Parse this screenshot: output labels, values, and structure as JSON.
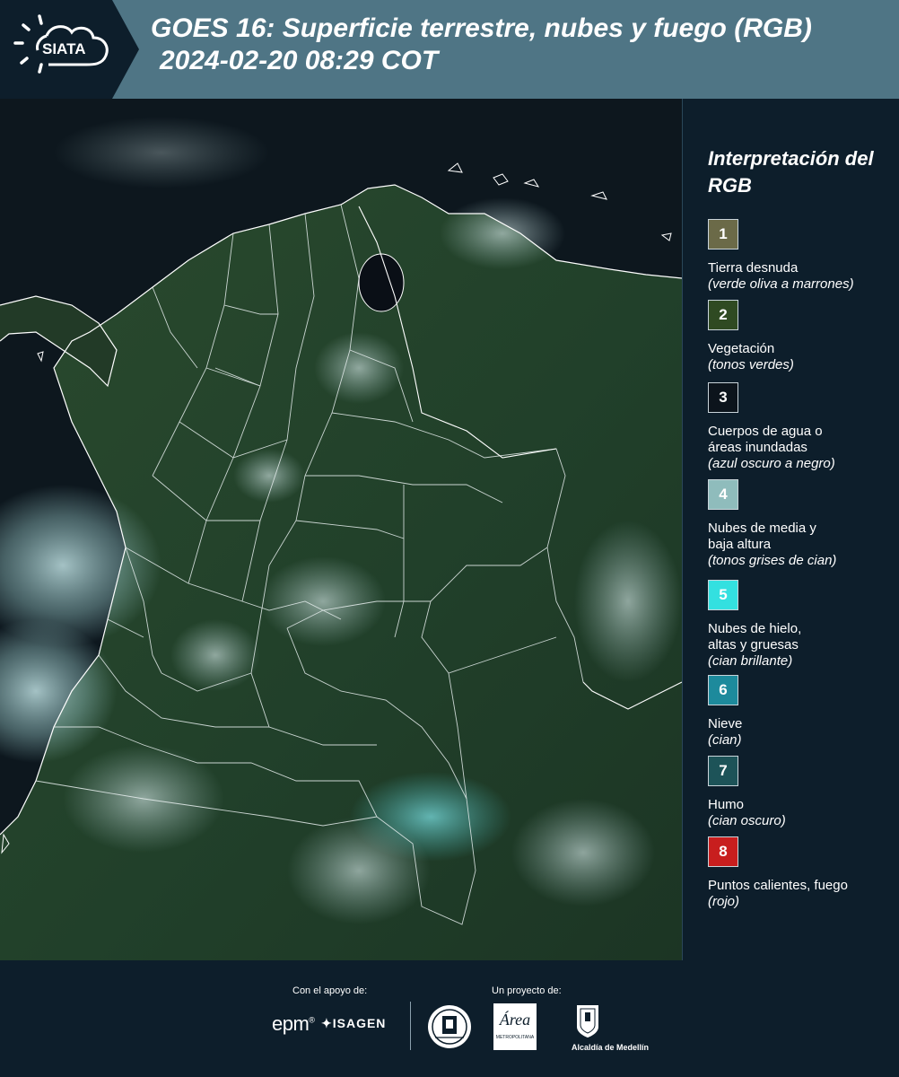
{
  "header": {
    "logo_text": "SIATA",
    "title_line1": "GOES 16: Superficie terrestre, nubes y fuego (RGB)",
    "title_line2": "2024-02-20 08:29 COT"
  },
  "legend": {
    "title": "Interpretación del RGB",
    "items": [
      {
        "number": "1",
        "label": "Tierra desnuda",
        "sub": "(verde oliva a marrones)",
        "color": "#6b6a48"
      },
      {
        "number": "2",
        "label": "Vegetación",
        "sub": "(tonos verdes)",
        "color": "#2f4a22"
      },
      {
        "number": "3",
        "label": "Cuerpos de agua o áreas inundadas",
        "sub": "(azul oscuro a negro)",
        "color": "#0c141c"
      },
      {
        "number": "4",
        "label": "Nubes de media y baja altura",
        "sub": "(tonos grises de cian)",
        "color": "#8fbcbc"
      },
      {
        "number": "5",
        "label": "Nubes de hielo, altas y gruesas",
        "sub": "(cian brillante)",
        "color": "#33e0e0"
      },
      {
        "number": "6",
        "label": "Nieve",
        "sub": "(cian)",
        "color": "#1d8a9c"
      },
      {
        "number": "7",
        "label": "Humo",
        "sub": "(cian oscuro)",
        "color": "#1d5358"
      },
      {
        "number": "8",
        "label": "Puntos calientes, fuego",
        "sub": "(rojo)",
        "color": "#c81e1e"
      }
    ]
  },
  "footer": {
    "support_label": "Con el apoyo de:",
    "project_label": "Un proyecto de:",
    "sponsor_epm": "epm",
    "sponsor_isagen": "ISAGEN",
    "area_metropolitana": "Área",
    "area_metropolitana_sub": "METROPOLITANA",
    "alcaldia": "Alcaldía de Medellín"
  },
  "colors": {
    "header_bg": "#4f7585",
    "page_bg": "#0d1e2b",
    "land": "#24402b",
    "sea": "#06090e",
    "border_line": "#ffffff"
  }
}
